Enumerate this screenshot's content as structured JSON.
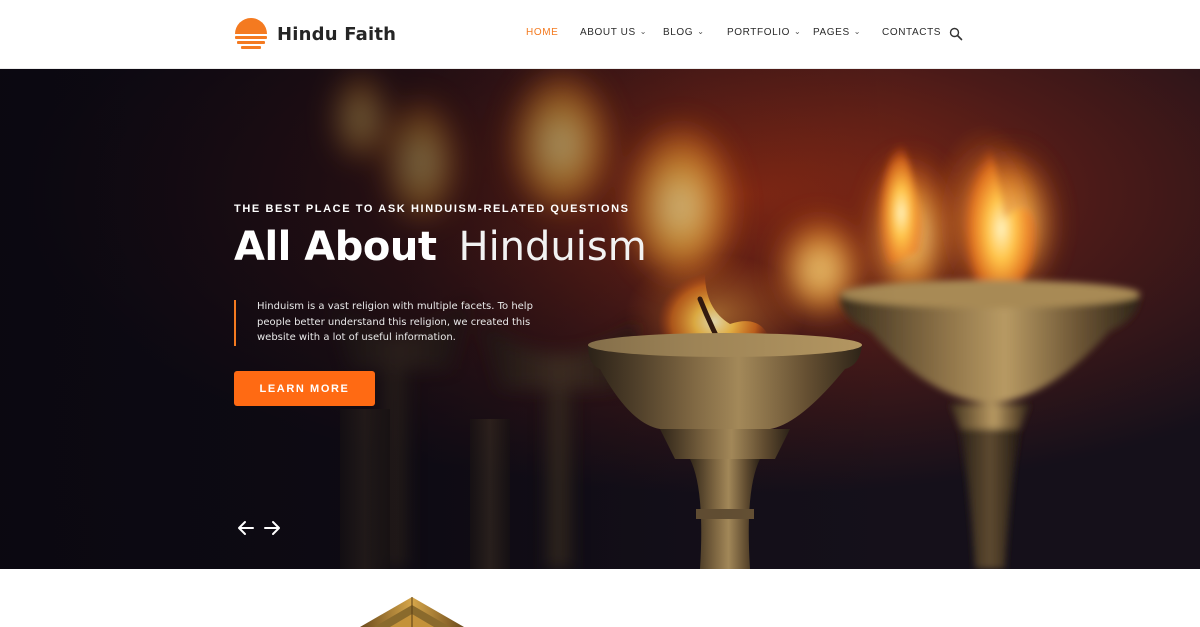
{
  "brand": {
    "name": "Hindu Faith",
    "accent": "#f47a20",
    "logo_icon": "sunset-icon"
  },
  "nav": {
    "items": [
      {
        "label": "HOME",
        "active": true,
        "has_dropdown": false
      },
      {
        "label": "ABOUT US",
        "active": false,
        "has_dropdown": true
      },
      {
        "label": "BLOG",
        "active": false,
        "has_dropdown": true
      },
      {
        "label": "PORTFOLIO",
        "active": false,
        "has_dropdown": true
      },
      {
        "label": "PAGES",
        "active": false,
        "has_dropdown": true
      },
      {
        "label": "CONTACTS",
        "active": false,
        "has_dropdown": false
      }
    ],
    "chevron_glyph": "⌄",
    "search_icon": "search-icon"
  },
  "hero": {
    "kicker": "THE BEST PLACE TO ASK HINDUISM-RELATED QUESTIONS",
    "title_bold": "All About",
    "title_light": "Hinduism",
    "description": "Hinduism is a vast religion with multiple facets. To help people better understand this religion, we created this website with a lot of useful information.",
    "cta_label": "LEARN MORE",
    "cta_color": "#ff6a13",
    "prev_icon": "arrow-left-icon",
    "next_icon": "arrow-right-icon"
  },
  "section_below": {
    "image_icon": "temple-icon"
  }
}
